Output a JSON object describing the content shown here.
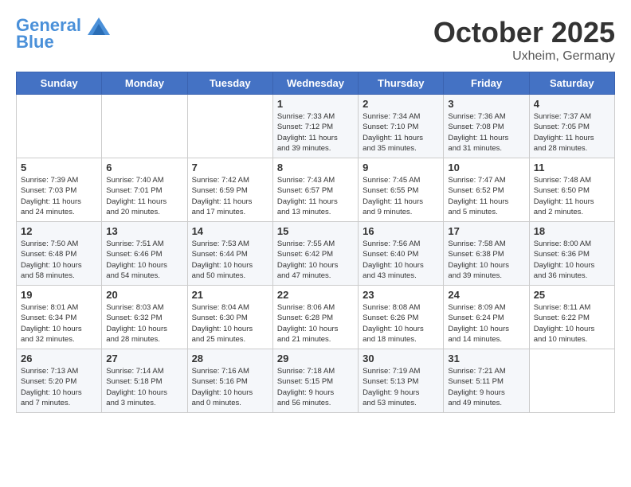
{
  "header": {
    "logo_line1": "General",
    "logo_line2": "Blue",
    "month": "October 2025",
    "location": "Uxheim, Germany"
  },
  "days_of_week": [
    "Sunday",
    "Monday",
    "Tuesday",
    "Wednesday",
    "Thursday",
    "Friday",
    "Saturday"
  ],
  "weeks": [
    [
      {
        "day": "",
        "info": ""
      },
      {
        "day": "",
        "info": ""
      },
      {
        "day": "",
        "info": ""
      },
      {
        "day": "1",
        "info": "Sunrise: 7:33 AM\nSunset: 7:12 PM\nDaylight: 11 hours\nand 39 minutes."
      },
      {
        "day": "2",
        "info": "Sunrise: 7:34 AM\nSunset: 7:10 PM\nDaylight: 11 hours\nand 35 minutes."
      },
      {
        "day": "3",
        "info": "Sunrise: 7:36 AM\nSunset: 7:08 PM\nDaylight: 11 hours\nand 31 minutes."
      },
      {
        "day": "4",
        "info": "Sunrise: 7:37 AM\nSunset: 7:05 PM\nDaylight: 11 hours\nand 28 minutes."
      }
    ],
    [
      {
        "day": "5",
        "info": "Sunrise: 7:39 AM\nSunset: 7:03 PM\nDaylight: 11 hours\nand 24 minutes."
      },
      {
        "day": "6",
        "info": "Sunrise: 7:40 AM\nSunset: 7:01 PM\nDaylight: 11 hours\nand 20 minutes."
      },
      {
        "day": "7",
        "info": "Sunrise: 7:42 AM\nSunset: 6:59 PM\nDaylight: 11 hours\nand 17 minutes."
      },
      {
        "day": "8",
        "info": "Sunrise: 7:43 AM\nSunset: 6:57 PM\nDaylight: 11 hours\nand 13 minutes."
      },
      {
        "day": "9",
        "info": "Sunrise: 7:45 AM\nSunset: 6:55 PM\nDaylight: 11 hours\nand 9 minutes."
      },
      {
        "day": "10",
        "info": "Sunrise: 7:47 AM\nSunset: 6:52 PM\nDaylight: 11 hours\nand 5 minutes."
      },
      {
        "day": "11",
        "info": "Sunrise: 7:48 AM\nSunset: 6:50 PM\nDaylight: 11 hours\nand 2 minutes."
      }
    ],
    [
      {
        "day": "12",
        "info": "Sunrise: 7:50 AM\nSunset: 6:48 PM\nDaylight: 10 hours\nand 58 minutes."
      },
      {
        "day": "13",
        "info": "Sunrise: 7:51 AM\nSunset: 6:46 PM\nDaylight: 10 hours\nand 54 minutes."
      },
      {
        "day": "14",
        "info": "Sunrise: 7:53 AM\nSunset: 6:44 PM\nDaylight: 10 hours\nand 50 minutes."
      },
      {
        "day": "15",
        "info": "Sunrise: 7:55 AM\nSunset: 6:42 PM\nDaylight: 10 hours\nand 47 minutes."
      },
      {
        "day": "16",
        "info": "Sunrise: 7:56 AM\nSunset: 6:40 PM\nDaylight: 10 hours\nand 43 minutes."
      },
      {
        "day": "17",
        "info": "Sunrise: 7:58 AM\nSunset: 6:38 PM\nDaylight: 10 hours\nand 39 minutes."
      },
      {
        "day": "18",
        "info": "Sunrise: 8:00 AM\nSunset: 6:36 PM\nDaylight: 10 hours\nand 36 minutes."
      }
    ],
    [
      {
        "day": "19",
        "info": "Sunrise: 8:01 AM\nSunset: 6:34 PM\nDaylight: 10 hours\nand 32 minutes."
      },
      {
        "day": "20",
        "info": "Sunrise: 8:03 AM\nSunset: 6:32 PM\nDaylight: 10 hours\nand 28 minutes."
      },
      {
        "day": "21",
        "info": "Sunrise: 8:04 AM\nSunset: 6:30 PM\nDaylight: 10 hours\nand 25 minutes."
      },
      {
        "day": "22",
        "info": "Sunrise: 8:06 AM\nSunset: 6:28 PM\nDaylight: 10 hours\nand 21 minutes."
      },
      {
        "day": "23",
        "info": "Sunrise: 8:08 AM\nSunset: 6:26 PM\nDaylight: 10 hours\nand 18 minutes."
      },
      {
        "day": "24",
        "info": "Sunrise: 8:09 AM\nSunset: 6:24 PM\nDaylight: 10 hours\nand 14 minutes."
      },
      {
        "day": "25",
        "info": "Sunrise: 8:11 AM\nSunset: 6:22 PM\nDaylight: 10 hours\nand 10 minutes."
      }
    ],
    [
      {
        "day": "26",
        "info": "Sunrise: 7:13 AM\nSunset: 5:20 PM\nDaylight: 10 hours\nand 7 minutes."
      },
      {
        "day": "27",
        "info": "Sunrise: 7:14 AM\nSunset: 5:18 PM\nDaylight: 10 hours\nand 3 minutes."
      },
      {
        "day": "28",
        "info": "Sunrise: 7:16 AM\nSunset: 5:16 PM\nDaylight: 10 hours\nand 0 minutes."
      },
      {
        "day": "29",
        "info": "Sunrise: 7:18 AM\nSunset: 5:15 PM\nDaylight: 9 hours\nand 56 minutes."
      },
      {
        "day": "30",
        "info": "Sunrise: 7:19 AM\nSunset: 5:13 PM\nDaylight: 9 hours\nand 53 minutes."
      },
      {
        "day": "31",
        "info": "Sunrise: 7:21 AM\nSunset: 5:11 PM\nDaylight: 9 hours\nand 49 minutes."
      },
      {
        "day": "",
        "info": ""
      }
    ]
  ]
}
